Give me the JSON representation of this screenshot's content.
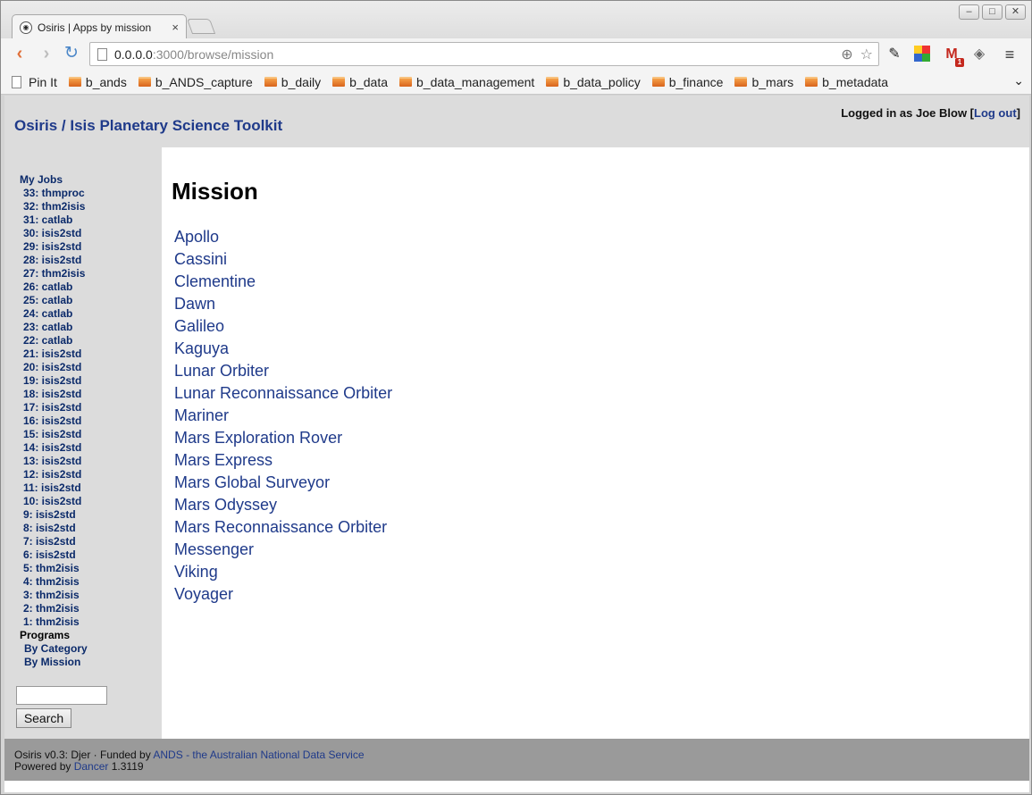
{
  "browser": {
    "tab_title": "Osiris | Apps by mission",
    "tab_close": "×",
    "url_host": "0.0.0.0",
    "url_path": ":3000/browse/mission",
    "bookmarks": [
      "b_ands",
      "b_ANDS_capture",
      "b_daily",
      "b_data",
      "b_data_management",
      "b_data_policy",
      "b_finance",
      "b_mars",
      "b_metadata"
    ],
    "bookmark_pin": "Pin It",
    "gmail_badge": "1",
    "icons": [
      "back-icon",
      "forward-icon",
      "reload-icon",
      "zoom-icon",
      "star-icon",
      "pin-icon",
      "color-picker-icon",
      "gmail-icon",
      "feed-icon",
      "menu-icon"
    ]
  },
  "header": {
    "site_title": "Osiris / Isis Planetary Science Toolkit",
    "login_prefix": "Logged in as Joe Blow [",
    "logout_label": "Log out",
    "login_suffix": "]"
  },
  "sidebar": {
    "my_jobs_label": "My Jobs",
    "jobs": [
      "33: thmproc",
      "32: thm2isis",
      "31: catlab",
      "30: isis2std",
      "29: isis2std",
      "28: isis2std",
      "27: thm2isis",
      "26: catlab",
      "25: catlab",
      "24: catlab",
      "23: catlab",
      "22: catlab",
      "21: isis2std",
      "20: isis2std",
      "19: isis2std",
      "18: isis2std",
      "17: isis2std",
      "16: isis2std",
      "15: isis2std",
      "14: isis2std",
      "13: isis2std",
      "12: isis2std",
      "11: isis2std",
      "10: isis2std",
      "9: isis2std",
      "8: isis2std",
      "7: isis2std",
      "6: isis2std",
      "5: thm2isis",
      "4: thm2isis",
      "3: thm2isis",
      "2: thm2isis",
      "1: thm2isis"
    ],
    "programs_label": "Programs",
    "programs": [
      "By Category",
      "By Mission"
    ],
    "search_value": "",
    "search_button": "Search"
  },
  "main": {
    "heading": "Mission",
    "missions": [
      "Apollo",
      "Cassini",
      "Clementine",
      "Dawn",
      "Galileo",
      "Kaguya",
      "Lunar Orbiter",
      "Lunar Reconnaissance Orbiter",
      "Mariner",
      "Mars Exploration Rover",
      "Mars Express",
      "Mars Global Surveyor",
      "Mars Odyssey",
      "Mars Reconnaissance Orbiter",
      "Messenger",
      "Viking",
      "Voyager"
    ]
  },
  "footer": {
    "line1_prefix": "Osiris v0.3: Djer · Funded by ",
    "ands_link": "ANDS - the Australian National Data Service",
    "line2_prefix": "Powered by ",
    "dancer_link": "Dancer",
    "dancer_version": " 1.3119"
  },
  "colors": {
    "link": "#1f3a8a",
    "header_bg": "#dcdcdc",
    "footer_bg": "#9a9a9a"
  }
}
